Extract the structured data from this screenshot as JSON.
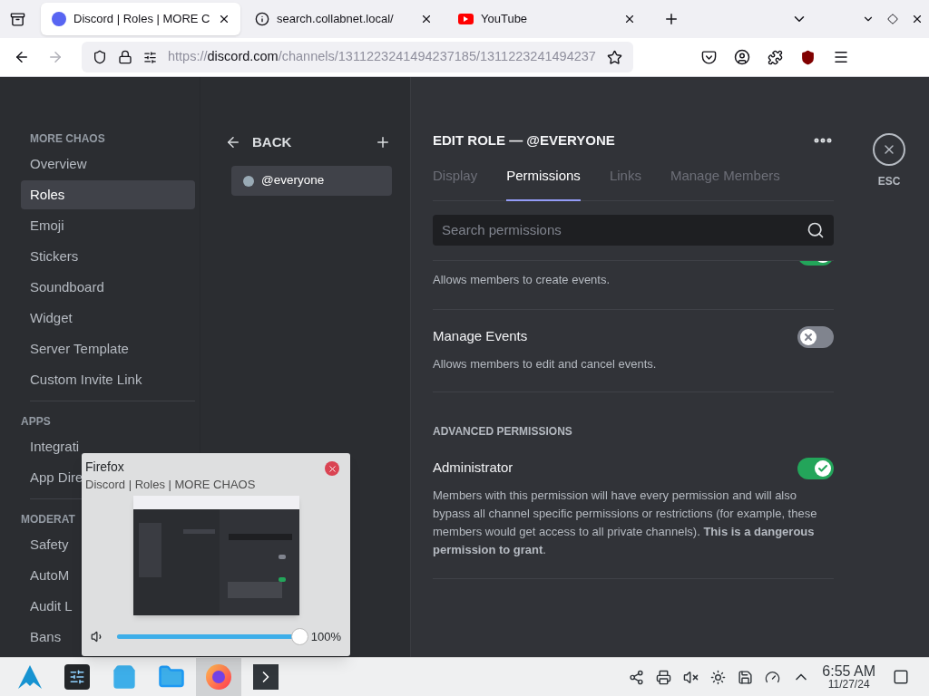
{
  "browser": {
    "tabs": [
      {
        "title": "Discord | Roles | MORE C",
        "kind": "discord",
        "selected": true
      },
      {
        "title": "search.collabnet.local/",
        "kind": "info",
        "selected": false
      },
      {
        "title": "YouTube",
        "kind": "youtube",
        "selected": false
      }
    ],
    "url": {
      "scheme": "https://",
      "host": "discord.com",
      "path": "/channels/1311223241494237185/1311223241494237"
    }
  },
  "sidebar": {
    "sections": [
      {
        "header": "MORE CHAOS",
        "items": [
          {
            "label": "Overview",
            "selected": false
          },
          {
            "label": "Roles",
            "selected": true
          },
          {
            "label": "Emoji",
            "selected": false
          },
          {
            "label": "Stickers",
            "selected": false
          },
          {
            "label": "Soundboard",
            "selected": false
          },
          {
            "label": "Widget",
            "selected": false
          },
          {
            "label": "Server Template",
            "selected": false
          },
          {
            "label": "Custom Invite Link",
            "selected": false
          }
        ]
      },
      {
        "header": "APPS",
        "items": [
          {
            "label": "Integrati",
            "selected": false
          },
          {
            "label": "App Dire",
            "selected": false
          }
        ]
      },
      {
        "header": "MODERAT",
        "items": [
          {
            "label": "Safety",
            "selected": false
          },
          {
            "label": "AutoM",
            "selected": false
          },
          {
            "label": "Audit L",
            "selected": false
          },
          {
            "label": "Bans",
            "selected": false
          }
        ]
      }
    ]
  },
  "roles_column": {
    "back_label": "BACK",
    "roles": [
      {
        "name": "@everyone",
        "selected": true,
        "color": "#99aab5"
      }
    ]
  },
  "edit_role": {
    "title": "EDIT ROLE — @EVERYONE",
    "close_label": "ESC",
    "tabs": [
      {
        "label": "Display",
        "selected": false,
        "disabled": true
      },
      {
        "label": "Permissions",
        "selected": true,
        "disabled": false
      },
      {
        "label": "Links",
        "selected": false,
        "disabled": true
      },
      {
        "label": "Manage Members",
        "selected": false,
        "disabled": true
      }
    ],
    "search": {
      "placeholder": "Search permissions"
    },
    "rows": [
      {
        "kind": "toggle",
        "description": "Allows members to create events.",
        "on": true
      },
      {
        "kind": "toggle",
        "title": "Manage Events",
        "description": "Allows members to edit and cancel events.",
        "on": false
      },
      {
        "kind": "header",
        "title": "ADVANCED PERMISSIONS"
      },
      {
        "kind": "toggle",
        "title": "Administrator",
        "description": "Members with this permission will have every permission and will also bypass all channel specific permissions or restrictions (for example, these members would get access to all private channels). **This is a dangerous permission to grant**.",
        "on": true
      }
    ]
  },
  "preview_popup": {
    "app": "Firefox",
    "window_title": "Discord | Roles | MORE CHAOS",
    "volume": {
      "level": 1,
      "reading": "100%"
    }
  },
  "taskbar": {
    "apps": [
      {
        "kind": "launcher",
        "selected": false
      },
      {
        "kind": "settings",
        "selected": false
      },
      {
        "kind": "store",
        "selected": false
      },
      {
        "kind": "files",
        "selected": false
      },
      {
        "kind": "firefox",
        "selected": true
      },
      {
        "kind": "terminal",
        "selected": false
      }
    ],
    "time": "6:55 AM",
    "date": "11/27/24"
  }
}
